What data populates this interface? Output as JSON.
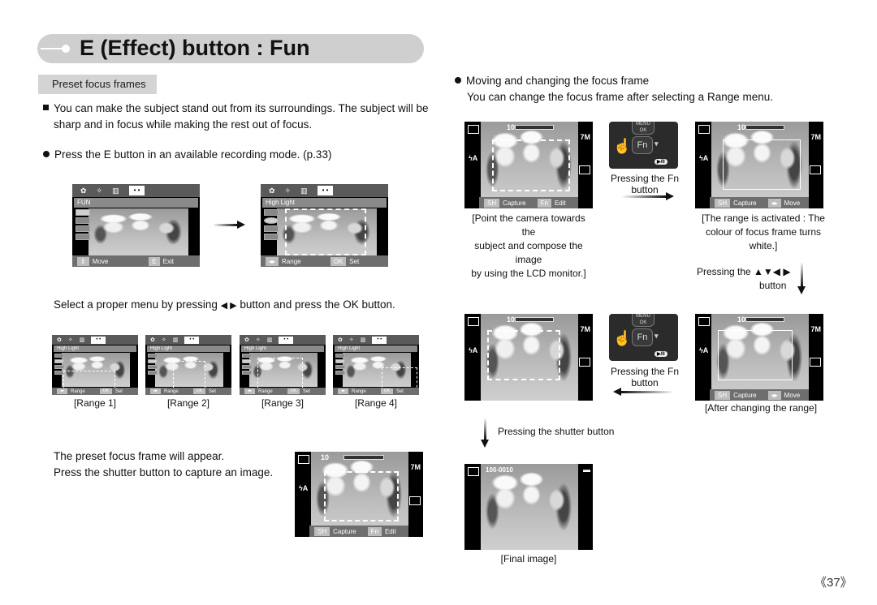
{
  "header": {
    "title": "E (Effect) button : Fun",
    "section": "Preset focus frames"
  },
  "left": {
    "intro_line1": "You can make the subject stand out from its surroundings. The subject will be",
    "intro_line2": "sharp and in focus while making the rest out of focus.",
    "step1": "Press the E button in an available recording mode. (p.33)",
    "screen_fun": {
      "menu_label": "FUN",
      "bar_left_key": "⇕",
      "bar_left": "Move",
      "bar_right_key": "E",
      "bar_right": "Exit"
    },
    "screen_highlight": {
      "menu_label": "High Light",
      "bar_left_key": "◂▸",
      "bar_left": "Range",
      "bar_right_key": "OK",
      "bar_right": "Set"
    },
    "step2_a": "Select a proper menu by pressing",
    "step2_keys": "◀ ▶",
    "step2_b": "button and press the OK button.",
    "ranges": [
      {
        "caption": "[Range 1]",
        "menu_label": "High Light",
        "k1": "◂▸",
        "l1": "Range",
        "k2": "OK",
        "l2": "Set"
      },
      {
        "caption": "[Range 2]",
        "menu_label": "High Light",
        "k1": "◂▸",
        "l1": "Range",
        "k2": "OK",
        "l2": "Set"
      },
      {
        "caption": "[Range 3]",
        "menu_label": "High Light",
        "k1": "◂▸",
        "l1": "Range",
        "k2": "OK",
        "l2": "Set"
      },
      {
        "caption": "[Range 4]",
        "menu_label": "High Light",
        "k1": "◂▸",
        "l1": "Range",
        "k2": "OK",
        "l2": "Set"
      }
    ],
    "step3_line1": "The preset focus frame will appear.",
    "step3_line2": "Press the shutter button to capture an image.",
    "preview": {
      "shots": "10",
      "resolution": "7M",
      "k1": "SH",
      "l1": "Capture",
      "k2": "Fn",
      "l2": "Edit"
    }
  },
  "right": {
    "heading": "Moving and changing the focus frame",
    "subheading": "You can change the focus frame after selecting a Range menu.",
    "screen_a": {
      "shots": "10",
      "resolution": "7M",
      "k1": "SH",
      "l1": "Capture",
      "k2": "Fn",
      "l2": "Edit",
      "caption_lines": [
        "[Point the camera towards the",
        "subject and compose the image",
        "by using the LCD monitor.]"
      ]
    },
    "fn_pad": {
      "menu_ok_top": "MENU",
      "menu_ok_bottom": "OK",
      "fn": "Fn",
      "play": "▶/II"
    },
    "fn_caption": "Pressing the Fn button",
    "screen_b": {
      "shots": "10",
      "resolution": "7M",
      "k1": "SH",
      "l1": "Capture",
      "k2": "◂▸",
      "l2": "Move",
      "caption_lines": [
        "[The range is activated : The",
        "colour of focus frame turns white.]"
      ]
    },
    "arrows_caption_a": "Pressing the ▲▼◀ ▶",
    "arrows_caption_b": "button",
    "screen_c": {
      "shots": "10",
      "resolution": "7M"
    },
    "fn_caption_2": "Pressing the Fn button",
    "screen_d": {
      "shots": "10",
      "resolution": "7M",
      "k1": "SH",
      "l1": "Capture",
      "k2": "◂▸",
      "l2": "Move",
      "caption": "[After changing the range]"
    },
    "shutter_caption": "Pressing the shutter button",
    "final": {
      "file": "100-0010",
      "caption": "[Final image]"
    }
  },
  "footer": {
    "page": "《37》"
  }
}
